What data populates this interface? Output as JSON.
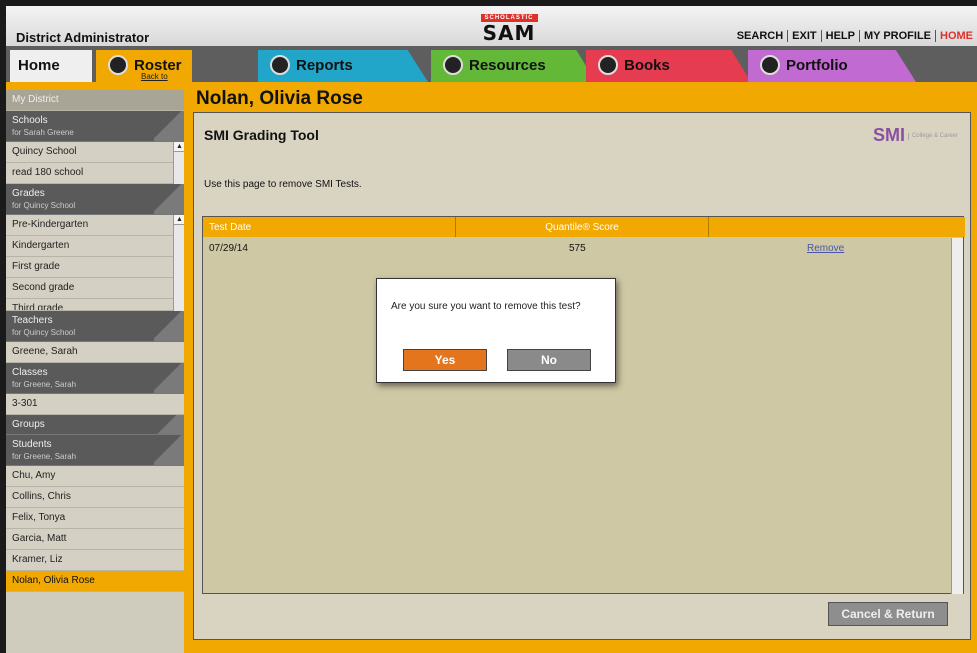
{
  "header": {
    "role": "District Administrator",
    "brand": "SCHOLASTIC",
    "app": "SAM",
    "links": [
      "SEARCH",
      "EXIT",
      "HELP",
      "MY PROFILE",
      "HOME"
    ]
  },
  "tabs": {
    "home": "Home",
    "roster": "Roster",
    "roster_sub": "Back to Profile",
    "reports": "Reports",
    "resources": "Resources",
    "books": "Books",
    "portfolio": "Portfolio"
  },
  "sidebar": {
    "my_district": "My District",
    "schools_label": "Schools",
    "schools_for": "for Sarah Greene",
    "schools": [
      "Quincy School",
      "read 180 school"
    ],
    "grades_label": "Grades",
    "grades_for": "for Quincy School",
    "grades": [
      "Pre-Kindergarten",
      "Kindergarten",
      "First grade",
      "Second grade",
      "Third grade"
    ],
    "teachers_label": "Teachers",
    "teachers_for": "for Quincy School",
    "teachers": [
      "Greene, Sarah"
    ],
    "classes_label": "Classes",
    "classes_for": "for Greene, Sarah",
    "classes": [
      "3-301"
    ],
    "groups_label": "Groups",
    "students_label": "Students",
    "students_for": "for Greene, Sarah",
    "students": [
      "Chu, Amy",
      "Collins, Chris",
      "Felix, Tonya",
      "Garcia, Matt",
      "Kramer, Liz",
      "Nolan, Olivia Rose"
    ]
  },
  "main": {
    "student_name": "Nolan, Olivia Rose",
    "page_title": "SMI Grading Tool",
    "smi_logo": "SMI",
    "smi_tag": "College & Career",
    "instruction": "Use this page to remove SMI Tests.",
    "columns": [
      "Test Date",
      "Quantile® Score"
    ],
    "rows": [
      {
        "date": "07/29/14",
        "score": "575",
        "action": "Remove"
      }
    ],
    "cancel_label": "Cancel & Return"
  },
  "modal": {
    "message": "Are you sure you want to remove this test?",
    "yes": "Yes",
    "no": "No"
  },
  "colors": {
    "accent": "#f1a800",
    "yes_button": "#e4751c",
    "reports": "#21a6c9",
    "resources": "#63b838",
    "books": "#e63c51",
    "portfolio": "#c16ad2"
  }
}
